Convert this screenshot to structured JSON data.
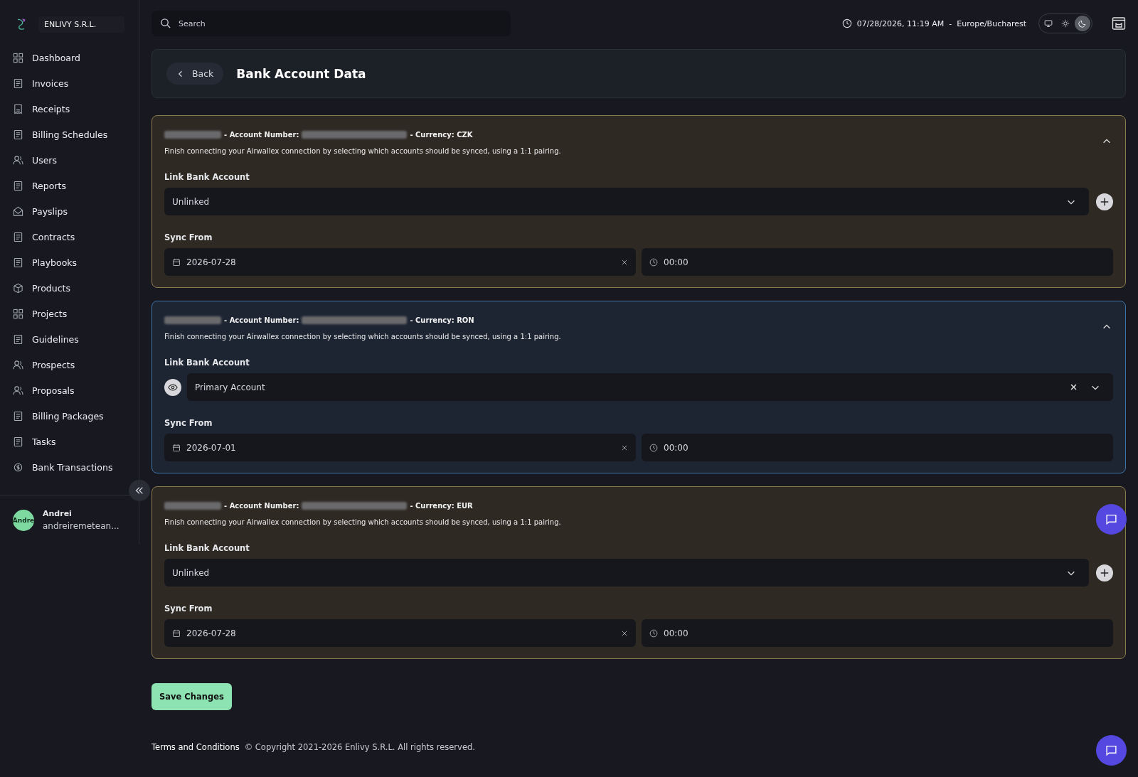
{
  "sidebar": {
    "company": "ENLIVY S.R.L.",
    "items": [
      {
        "label": "Dashboard"
      },
      {
        "label": "Invoices"
      },
      {
        "label": "Receipts"
      },
      {
        "label": "Billing Schedules"
      },
      {
        "label": "Users"
      },
      {
        "label": "Reports"
      },
      {
        "label": "Payslips"
      },
      {
        "label": "Contracts"
      },
      {
        "label": "Playbooks"
      },
      {
        "label": "Products"
      },
      {
        "label": "Projects"
      },
      {
        "label": "Guidelines"
      },
      {
        "label": "Prospects"
      },
      {
        "label": "Proposals"
      },
      {
        "label": "Billing Packages"
      },
      {
        "label": "Tasks"
      },
      {
        "label": "Bank Transactions"
      }
    ],
    "user": {
      "avatar_text": "Andre",
      "name": "Andrei",
      "email": "andreiremetean..."
    }
  },
  "topbar": {
    "search": {
      "placeholder": "Search"
    },
    "datetime": "07/28/2026, 11:19 AM",
    "separator": "-",
    "timezone": "Europe/Bucharest",
    "theme_options": [
      {
        "kind": "monitor",
        "selected": false
      },
      {
        "kind": "sun",
        "selected": false
      },
      {
        "kind": "moon",
        "selected": true
      }
    ]
  },
  "header": {
    "back": "Back",
    "title": "Bank Account Data"
  },
  "accounts": [
    {
      "linked": false,
      "account_number_label": "- Account Number:",
      "currency": "- Currency: CZK",
      "description": "Finish connecting your Airwallex connection by selecting which accounts should be synced, using a 1:1 pairing.",
      "link_label": "Link Bank Account",
      "link_value": "Unlinked",
      "sync_label": "Sync From",
      "date": "2026-07-28",
      "time": "00:00"
    },
    {
      "linked": true,
      "account_number_label": "- Account Number:",
      "currency": "- Currency: RON",
      "description": "Finish connecting your Airwallex connection by selecting which accounts should be synced, using a 1:1 pairing.",
      "link_label": "Link Bank Account",
      "link_value": "Primary Account",
      "sync_label": "Sync From",
      "date": "2026-07-01",
      "time": "00:00"
    },
    {
      "linked": false,
      "account_number_label": "- Account Number:",
      "currency": "- Currency: EUR",
      "description": "Finish connecting your Airwallex connection by selecting which accounts should be synced, using a 1:1 pairing.",
      "link_label": "Link Bank Account",
      "link_value": "Unlinked",
      "sync_label": "Sync From",
      "date": "2026-07-28",
      "time": "00:00"
    }
  ],
  "save_button": "Save Changes",
  "footer": {
    "terms": "Terms and Conditions",
    "copyright": "© Copyright 2021-2026 Enlivy S.R.L. All rights reserved."
  }
}
